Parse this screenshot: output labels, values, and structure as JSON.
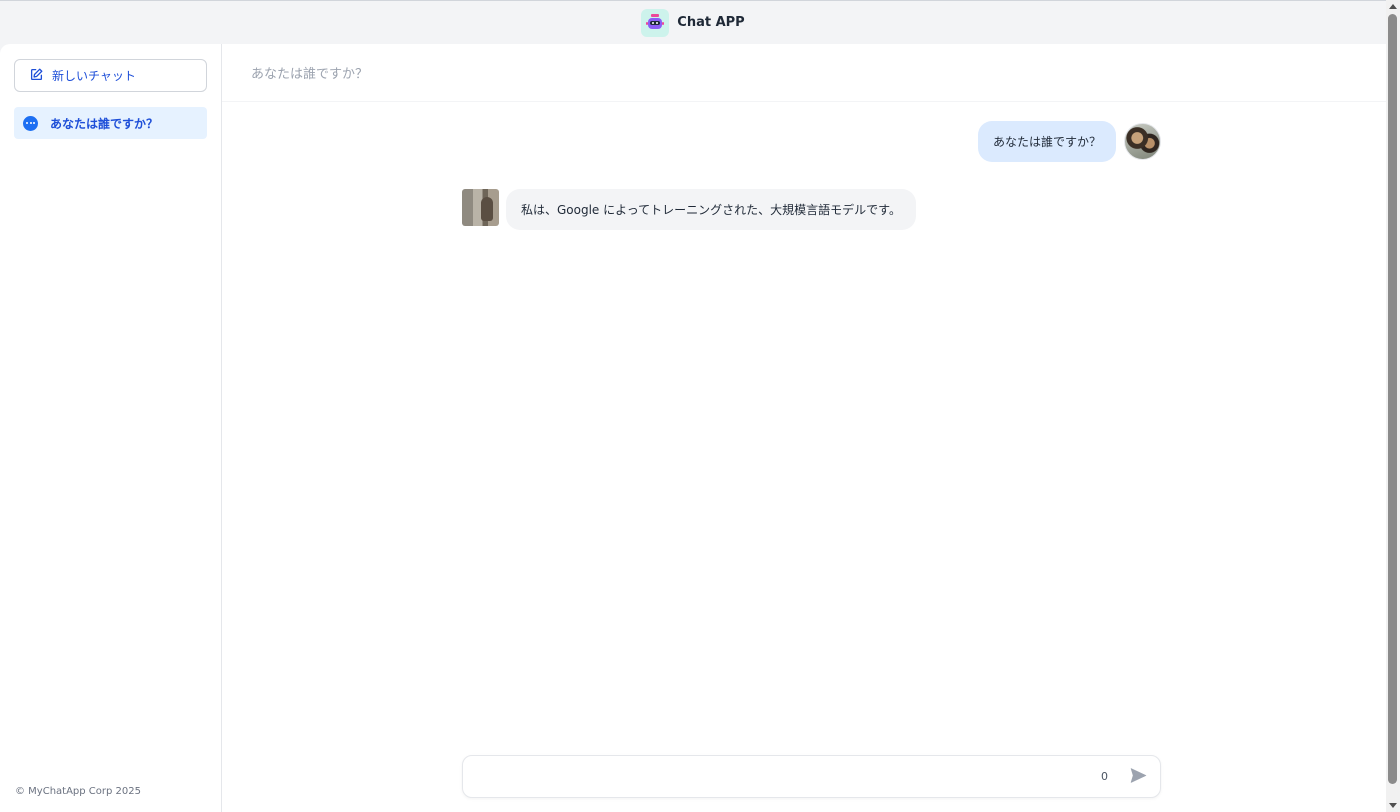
{
  "app": {
    "title": "Chat APP"
  },
  "sidebar": {
    "new_chat_label": "新しいチャット",
    "history": [
      {
        "label": "あなたは誰ですか？",
        "active": true
      }
    ],
    "footer": "© MyChatApp Corp 2025"
  },
  "conversation": {
    "title": "あなたは誰ですか？",
    "messages": [
      {
        "role": "user",
        "text": "あなたは誰ですか？"
      },
      {
        "role": "assistant",
        "text": "私は、Google によってトレーニングされた、大規模言語モデルです。"
      }
    ]
  },
  "composer": {
    "value": "",
    "char_count": "0"
  },
  "icons": {
    "new_chat": "edit-icon",
    "history": "chat-bubble-icon",
    "send": "send-icon",
    "app": "robot-icon"
  },
  "colors": {
    "accent": "#1d4ed8",
    "user_bubble": "#dbeafe",
    "assistant_bubble": "#f3f4f6",
    "active_item": "#e6f2ff"
  }
}
